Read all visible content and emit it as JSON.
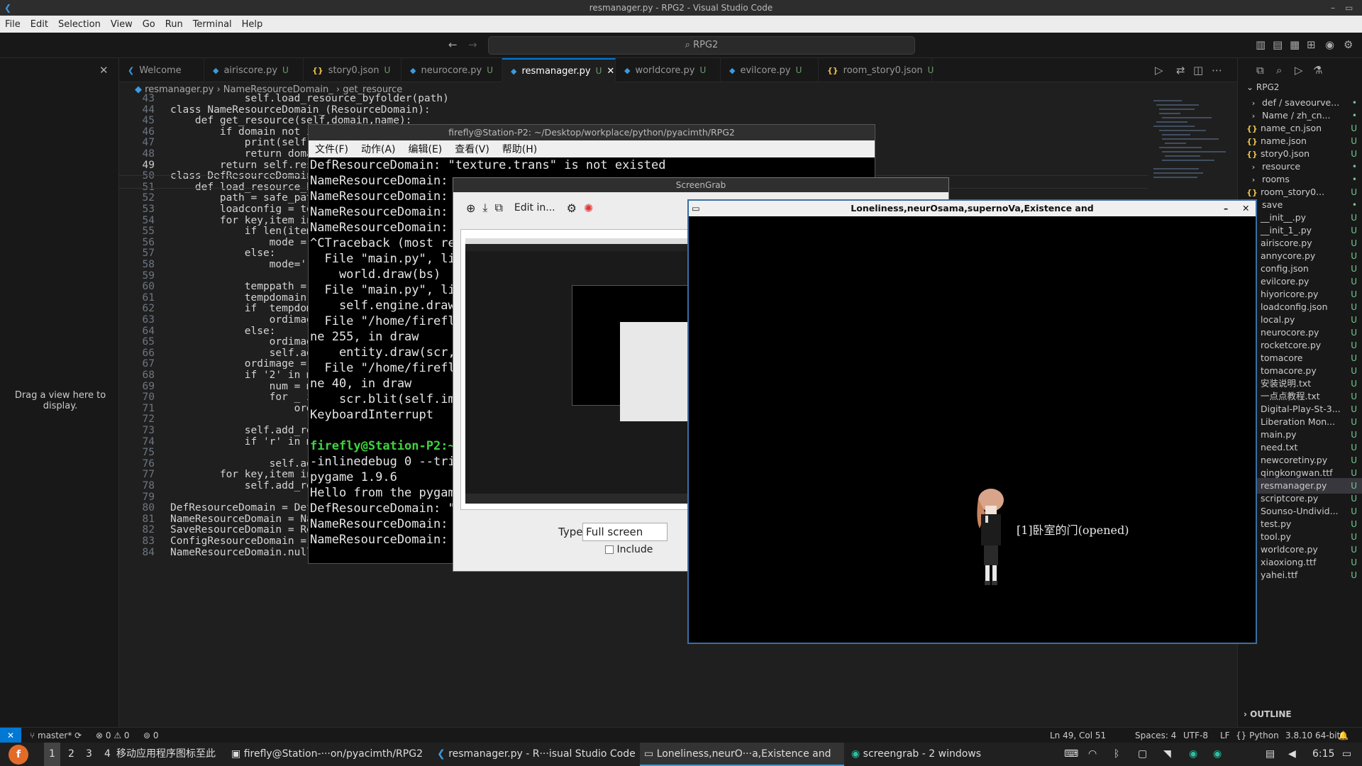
{
  "window_title": "resmanager.py - RPG2 - Visual Studio Code",
  "menu": [
    "File",
    "Edit",
    "Selection",
    "View",
    "Go",
    "Run",
    "Terminal",
    "Help"
  ],
  "command_center": "RPG2",
  "left_panel_hint": "Drag a view here to display.",
  "tabs": [
    {
      "label": "Welcome",
      "status": "",
      "icon": "vscode-icon"
    },
    {
      "label": "airiscore.py",
      "status": "U",
      "icon": "python-file-icon"
    },
    {
      "label": "story0.json",
      "status": "U",
      "icon": "json-file-icon"
    },
    {
      "label": "neurocore.py",
      "status": "U",
      "icon": "python-file-icon"
    },
    {
      "label": "resmanager.py",
      "status": "U",
      "icon": "python-file-icon",
      "active": true
    },
    {
      "label": "worldcore.py",
      "status": "U",
      "icon": "python-file-icon"
    },
    {
      "label": "evilcore.py",
      "status": "U",
      "icon": "python-file-icon"
    },
    {
      "label": "room_story0.json",
      "status": "U",
      "icon": "json-file-icon"
    }
  ],
  "breadcrumb": {
    "file": "resmanager.py",
    "cls": "NameResourceDomain_",
    "method": "get_resource"
  },
  "editor": {
    "lines": [
      {
        "n": "43",
        "t": "            self.load_resource_byfolder(path)"
      },
      {
        "n": "44",
        "t": "class NameResourceDomain_(ResourceDomain):"
      },
      {
        "n": "45",
        "t": "    def get_resource(self,domain,name):"
      },
      {
        "n": "46",
        "t": "        if domain not in self.resources:"
      },
      {
        "n": "47",
        "t": "            print(self."
      },
      {
        "n": "48",
        "t": "            return doma"
      },
      {
        "n": "49",
        "t": "        return self.res"
      },
      {
        "n": "50",
        "t": "class DefResourceDomain"
      },
      {
        "n": "51",
        "t": "    def load_resource_b"
      },
      {
        "n": "52",
        "t": "        path = safe_pat"
      },
      {
        "n": "53",
        "t": "        loadconfig = to"
      },
      {
        "n": "54",
        "t": "        for key,item in"
      },
      {
        "n": "55",
        "t": "            if len(item"
      },
      {
        "n": "56",
        "t": "                mode = "
      },
      {
        "n": "57",
        "t": "            else:"
      },
      {
        "n": "58",
        "t": "                mode=''"
      },
      {
        "n": "59",
        "t": ""
      },
      {
        "n": "60",
        "t": "            temppath = "
      },
      {
        "n": "61",
        "t": "            tempdomain "
      },
      {
        "n": "62",
        "t": "            if  tempdom"
      },
      {
        "n": "63",
        "t": "                ordimag"
      },
      {
        "n": "64",
        "t": "            else:"
      },
      {
        "n": "65",
        "t": "                ordimag"
      },
      {
        "n": "66",
        "t": "                self.ad"
      },
      {
        "n": "67",
        "t": "            ordimage = "
      },
      {
        "n": "68",
        "t": "            if '2' in m"
      },
      {
        "n": "69",
        "t": "                num = m"
      },
      {
        "n": "70",
        "t": "                for _ i"
      },
      {
        "n": "71",
        "t": "                    ord"
      },
      {
        "n": "72",
        "t": ""
      },
      {
        "n": "73",
        "t": "            self.add_re"
      },
      {
        "n": "74",
        "t": "            if 'r' in m"
      },
      {
        "n": "75",
        "t": ""
      },
      {
        "n": "76",
        "t": "                self.ad"
      },
      {
        "n": "77",
        "t": "        for key,item in"
      },
      {
        "n": "78",
        "t": "            self.add_resource(key,item)"
      },
      {
        "n": "79",
        "t": ""
      },
      {
        "n": "80",
        "t": "DefResourceDomain = DefResourceDomain_('DefResourceDomain')"
      },
      {
        "n": "81",
        "t": "NameResourceDomain = NameResourceDomain_('NameResourceDomain')"
      },
      {
        "n": "82",
        "t": "SaveResourceDomain = ResourceDomain('SaveResourceDomain')"
      },
      {
        "n": "83",
        "t": "ConfigResourceDomain = ResourceDomain('ConfigResourceDomain')"
      },
      {
        "n": "84",
        "t": "NameResourceDomain.null='illgeal domain'"
      }
    ]
  },
  "explorer": {
    "root": "RPG2",
    "items": [
      {
        "label": "def / saveourve...",
        "status": "•",
        "kind": "folder"
      },
      {
        "label": "Name / zh_cn...",
        "status": "•",
        "kind": "folder"
      },
      {
        "label": "name_cn.json",
        "status": "U",
        "kind": "json"
      },
      {
        "label": "name.json",
        "status": "U",
        "kind": "json"
      },
      {
        "label": "story0.json",
        "status": "U",
        "kind": "json"
      },
      {
        "label": "resource",
        "status": "•",
        "kind": "folder"
      },
      {
        "label": "rooms",
        "status": "•",
        "kind": "folder"
      },
      {
        "label": "room_story0...",
        "status": "U",
        "kind": "json"
      },
      {
        "label": "save",
        "status": "•",
        "kind": "folder"
      },
      {
        "label": "__init__.py",
        "status": "U",
        "kind": "py"
      },
      {
        "label": "__init_1_.py",
        "status": "U",
        "kind": "py"
      },
      {
        "label": "airiscore.py",
        "status": "U",
        "kind": "py"
      },
      {
        "label": "annycore.py",
        "status": "U",
        "kind": "py"
      },
      {
        "label": "config.json",
        "status": "U",
        "kind": "json"
      },
      {
        "label": "evilcore.py",
        "status": "U",
        "kind": "py"
      },
      {
        "label": "hiyoricore.py",
        "status": "U",
        "kind": "py"
      },
      {
        "label": "loadconfig.json",
        "status": "U",
        "kind": "json"
      },
      {
        "label": "local.py",
        "status": "U",
        "kind": "py"
      },
      {
        "label": "neurocore.py",
        "status": "U",
        "kind": "py"
      },
      {
        "label": "rocketcore.py",
        "status": "U",
        "kind": "py"
      },
      {
        "label": "tomacore",
        "status": "U",
        "kind": "txt"
      },
      {
        "label": "tomacore.py",
        "status": "U",
        "kind": "py"
      },
      {
        "label": "安装说明.txt",
        "status": "U",
        "kind": "txt"
      },
      {
        "label": "一点点教程.txt",
        "status": "U",
        "kind": "txt"
      },
      {
        "label": "Digital-Play-St-3...",
        "status": "U",
        "kind": "ttf"
      },
      {
        "label": "Liberation Mon...",
        "status": "U",
        "kind": "ttf"
      },
      {
        "label": "main.py",
        "status": "U",
        "kind": "py"
      },
      {
        "label": "need.txt",
        "status": "U",
        "kind": "txt"
      },
      {
        "label": "newcoretiny.py",
        "status": "U",
        "kind": "py"
      },
      {
        "label": "qingkongwan.ttf",
        "status": "U",
        "kind": "ttf"
      },
      {
        "label": "resmanager.py",
        "status": "U",
        "kind": "py"
      },
      {
        "label": "scriptcore.py",
        "status": "U",
        "kind": "py"
      },
      {
        "label": "Sounso-Undivid...",
        "status": "U",
        "kind": "ttf"
      },
      {
        "label": "test.py",
        "status": "U",
        "kind": "py"
      },
      {
        "label": "tool.py",
        "status": "U",
        "kind": "py"
      },
      {
        "label": "worldcore.py",
        "status": "U",
        "kind": "py"
      },
      {
        "label": "xiaoxiong.ttf",
        "status": "U",
        "kind": "ttf"
      },
      {
        "label": "yahei.ttf",
        "status": "U",
        "kind": "ttf"
      }
    ],
    "outline": "OUTLINE"
  },
  "terminal": {
    "title": "firefly@Station-P2: ~/Desktop/workplace/python/pyacimth/RPG2",
    "menu": [
      "文件(F)",
      "动作(A)",
      "编辑(E)",
      "查看(V)",
      "帮助(H)"
    ],
    "lines": [
      "DefResourceDomain: \"texture.trans\" is not existed",
      "NameResourceDomain:",
      "NameResourceDomain:",
      "NameResourceDomain:",
      "NameResourceDomain:",
      "^CTraceback (most re",
      "  File \"main.py\", li",
      "    world.draw(bs)",
      "  File \"main.py\", li",
      "    self.engine.draw",
      "  File \"/home/firefl",
      "ne 255, in draw",
      "    entity.draw(scr,",
      "  File \"/home/firefl",
      "ne 40, in draw",
      "    scr.blit(self.im",
      "KeyboardInterrupt",
      "",
      "firefly@Station-P2:~",
      "-inlinedebug 0 --tri",
      "pygame 1.9.6",
      "Hello from the pygam",
      "DefResourceDomain: \"",
      "NameResourceDomain:",
      "NameResourceDomain:"
    ]
  },
  "screengrab": {
    "title": "ScreenGrab",
    "edit_label": "Edit in...",
    "type_label": "Type:",
    "type_value": "Full screen",
    "include_label": "Include"
  },
  "game": {
    "title": "Loneliness,neurOsama,supernoVa,Existence and",
    "label": "[1]卧室的门(opened)"
  },
  "status": {
    "branch": "master*",
    "errors": "0",
    "warnings": "0",
    "ports": "0",
    "position": "Ln 49, Col 51",
    "spaces": "Spaces: 4",
    "encoding": "UTF-8",
    "eol": "LF",
    "language": "Python",
    "interpreter": "3.8.10 64-bit"
  },
  "taskbar": {
    "workspaces": [
      "1",
      "2",
      "3",
      "4"
    ],
    "hint": "移动应用程序图标至此",
    "tasks": [
      "firefly@Station-···on/pyacimth/RPG2",
      "resmanager.py - R···isual Studio Code",
      "Loneliness,neurO···a,Existence and",
      "screengrab - 2 windows"
    ],
    "clock": "6:15"
  }
}
